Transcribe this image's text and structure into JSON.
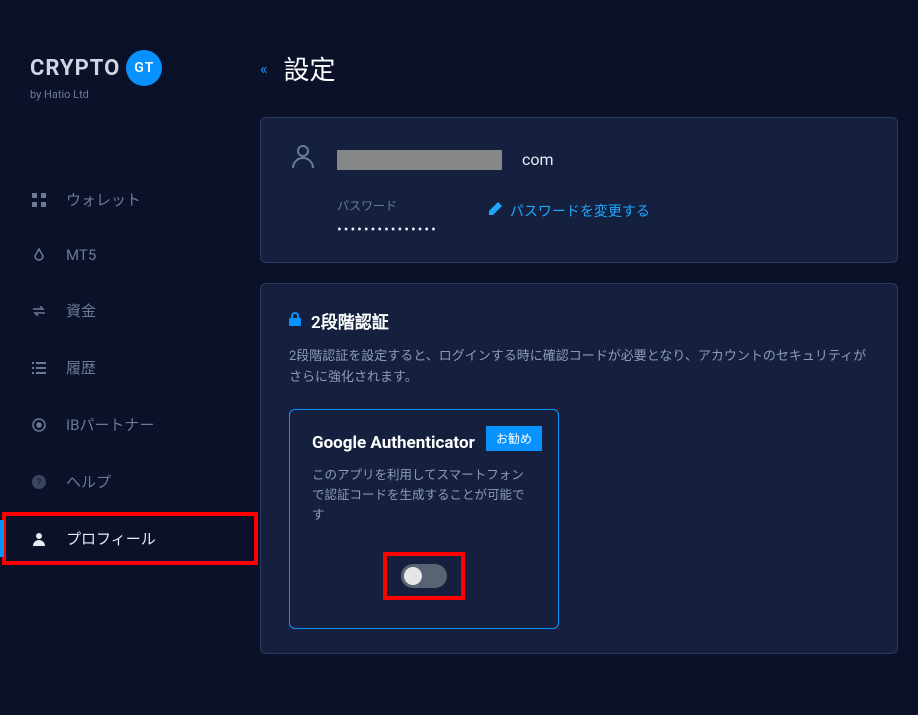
{
  "brand": {
    "name": "CRYPTO",
    "badge": "GT",
    "subtitle": "by Hatio Ltd"
  },
  "sidebar": {
    "items": [
      {
        "label": "ウォレット"
      },
      {
        "label": "MT5"
      },
      {
        "label": "資金"
      },
      {
        "label": "履歴"
      },
      {
        "label": "IBパートナー"
      },
      {
        "label": "ヘルプ"
      },
      {
        "label": "プロフィール"
      }
    ]
  },
  "page": {
    "title": "設定"
  },
  "profile": {
    "email_suffix": "com",
    "password_label": "パスワード",
    "password_masked": "•••••••••••••••",
    "change_password": "パスワードを変更する"
  },
  "twoFactor": {
    "title": "2段階認証",
    "description": "2段階認証を設定すると、ログインする時に確認コードが必要となり、アカウントのセキュリティがさらに強化されます。",
    "card": {
      "title": "Google Authenticator",
      "badge": "お勧め",
      "description": "このアプリを利用してスマートフォンで認証コードを生成することが可能です"
    }
  }
}
